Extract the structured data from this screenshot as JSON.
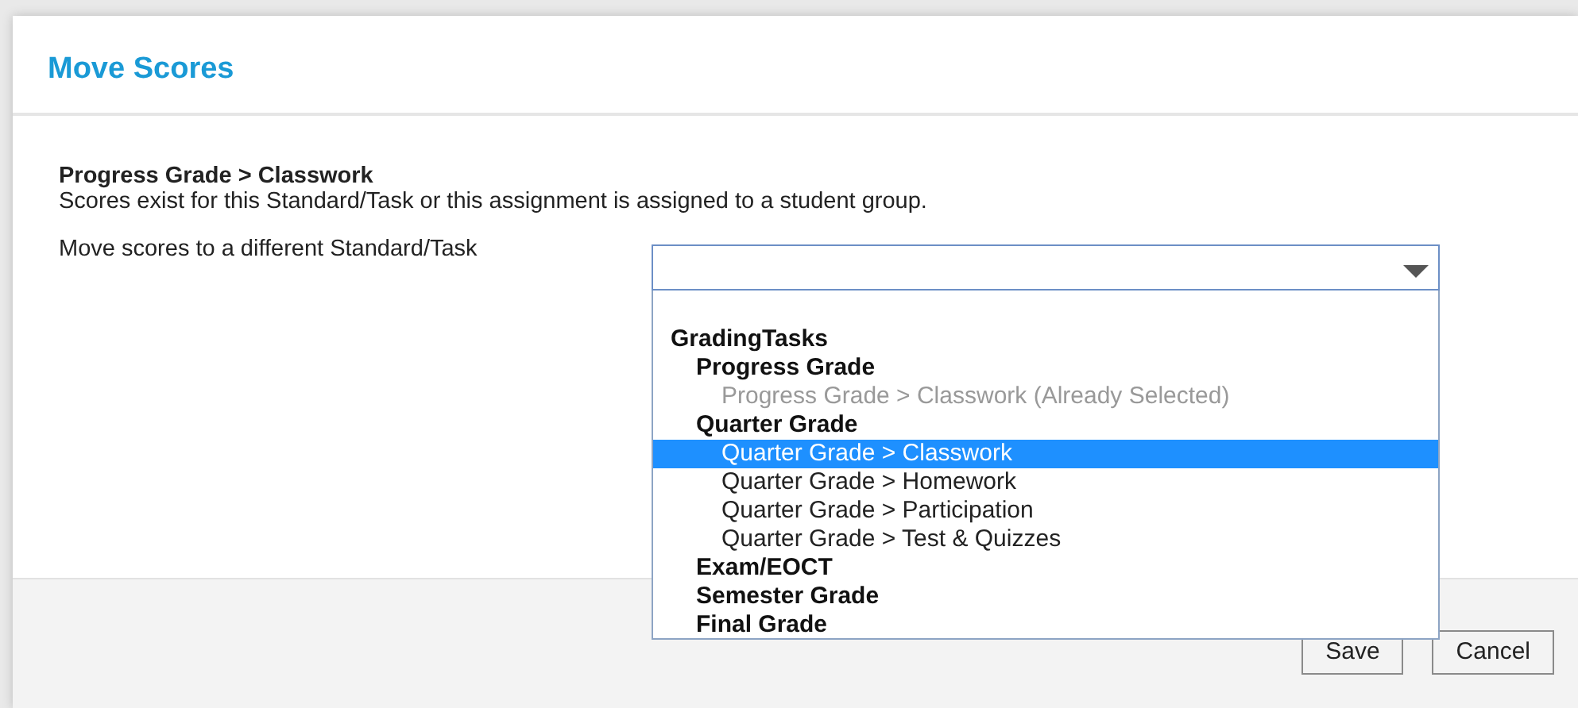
{
  "dialog": {
    "title": "Move Scores",
    "heading": "Progress Grade > Classwork",
    "message": "Scores exist for this Standard/Task or this assignment is assigned to a student group.",
    "field_label": "Move scores to a different Standard/Task",
    "dropdown": {
      "expanded": true,
      "tree": [
        {
          "kind": "group",
          "label": "GradingTasks",
          "children": [
            {
              "kind": "group",
              "label": "Progress Grade",
              "children": [
                {
                  "kind": "option",
                  "label": "Progress Grade > Classwork (Already Selected)",
                  "disabled": true,
                  "selected": false
                }
              ]
            },
            {
              "kind": "group",
              "label": "Quarter Grade",
              "children": [
                {
                  "kind": "option",
                  "label": "Quarter Grade > Classwork",
                  "disabled": false,
                  "selected": true
                },
                {
                  "kind": "option",
                  "label": "Quarter Grade > Homework",
                  "disabled": false,
                  "selected": false
                },
                {
                  "kind": "option",
                  "label": "Quarter Grade > Participation",
                  "disabled": false,
                  "selected": false
                },
                {
                  "kind": "option",
                  "label": "Quarter Grade > Test & Quizzes",
                  "disabled": false,
                  "selected": false
                }
              ]
            },
            {
              "kind": "group",
              "label": "Exam/EOCT"
            },
            {
              "kind": "group",
              "label": "Semester Grade"
            },
            {
              "kind": "group",
              "label": "Final Grade"
            }
          ]
        }
      ]
    },
    "buttons": [
      "Save",
      "Cancel"
    ]
  }
}
